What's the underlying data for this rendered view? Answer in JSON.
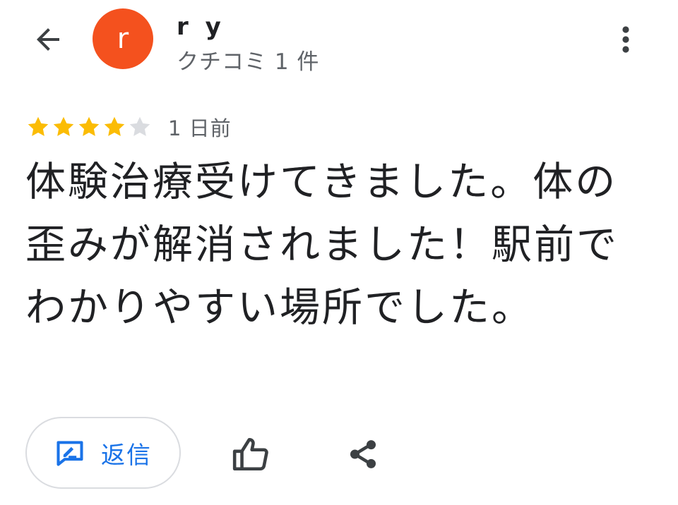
{
  "header": {
    "user_name": "r y",
    "avatar_initial": "r",
    "avatar_color": "#f4511e",
    "review_count": "クチコミ 1 件",
    "back_icon": "arrow-left-icon",
    "more_icon": "more-vertical-icon"
  },
  "review": {
    "rating": 4,
    "max_rating": 5,
    "star_filled_color": "#fbbc04",
    "star_empty_color": "#dadce0",
    "date": "1 日前",
    "text": "体験治療受けてきました。体の歪みが解消されました！駅前でわかりやすい場所でした。"
  },
  "actions": {
    "reply_label": "返信",
    "reply_icon": "edit-reply-icon",
    "like_icon": "thumb-up-icon",
    "share_icon": "share-icon",
    "accent_color": "#1a73e8"
  }
}
